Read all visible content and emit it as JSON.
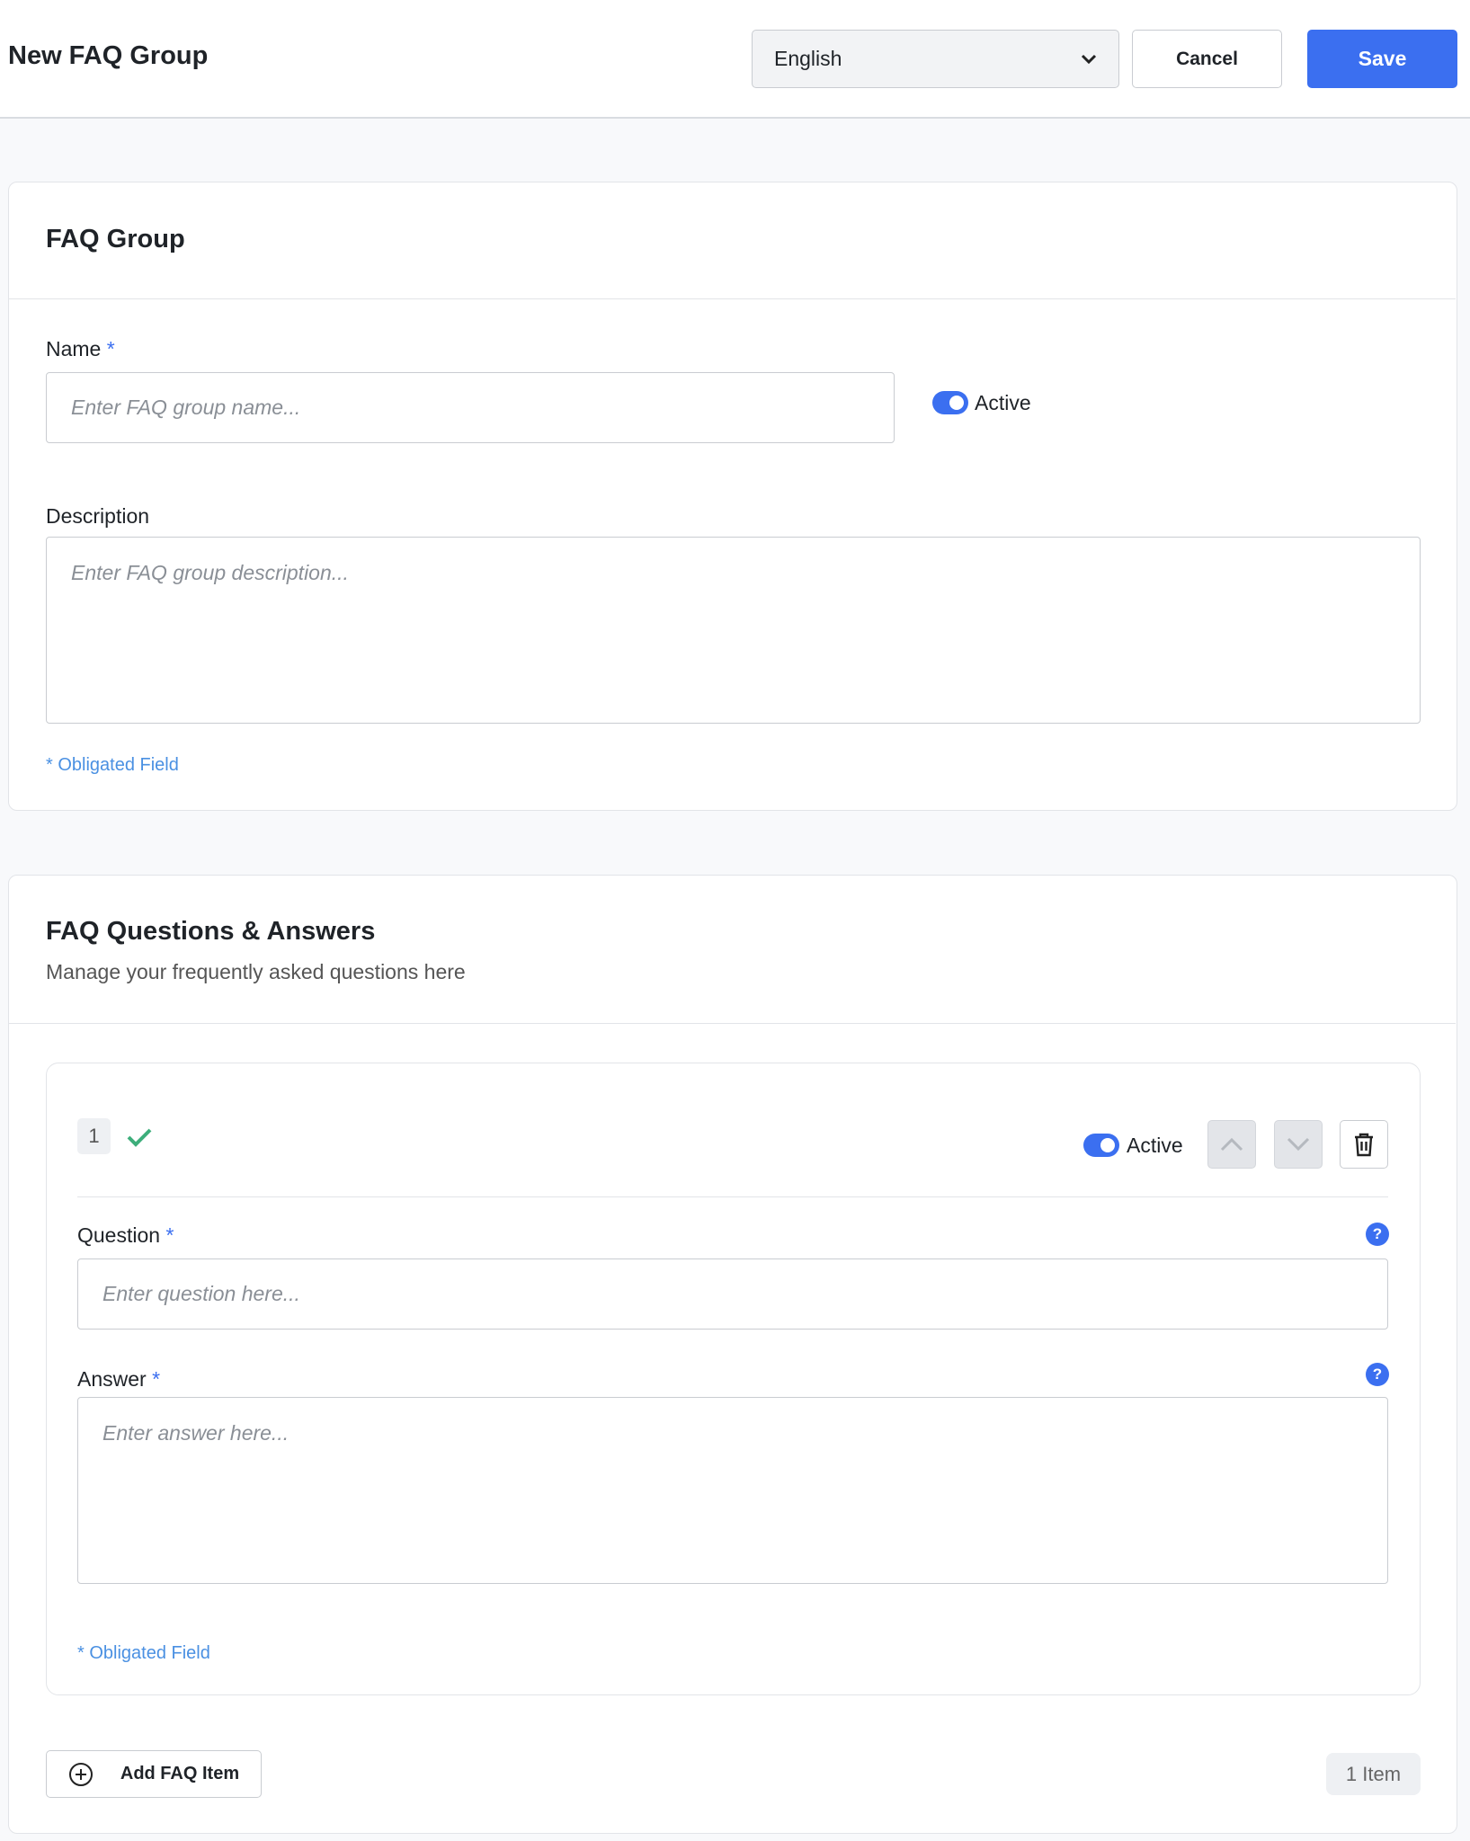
{
  "header": {
    "title": "New FAQ Group",
    "language": "English",
    "cancel": "Cancel",
    "save": "Save"
  },
  "group": {
    "title": "FAQ Group",
    "name_label": "Name",
    "required": "*",
    "name_placeholder": "Enter FAQ group name...",
    "active_label": "Active",
    "active": true,
    "description_label": "Description",
    "description_placeholder": "Enter FAQ group description...",
    "obligated": "*  Obligated Field"
  },
  "qa": {
    "title": "FAQ Questions & Answers",
    "subtitle": "Manage your frequently asked questions here",
    "items": [
      {
        "index": "1",
        "active_label": "Active",
        "active": true,
        "question_label": "Question",
        "question_placeholder": "Enter question here...",
        "answer_label": "Answer",
        "answer_placeholder": "Enter answer here...",
        "obligated": "*  Obligated Field",
        "help": "?"
      }
    ],
    "add_label": "Add FAQ Item",
    "count": "1 Item"
  },
  "colors": {
    "accent": "#3b6ff0",
    "success": "#3dae7b",
    "link": "#4a90e2"
  }
}
